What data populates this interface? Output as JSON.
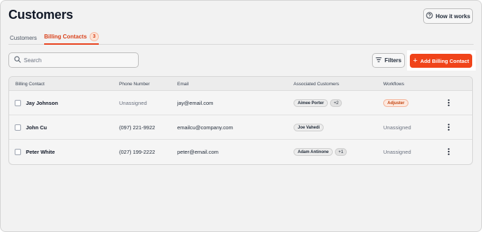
{
  "header": {
    "title": "Customers",
    "how_it_works_label": "How it works"
  },
  "tabs": [
    {
      "label": "Customers",
      "active": false
    },
    {
      "label": "Billing Contacts",
      "active": true,
      "count": "3"
    }
  ],
  "toolbar": {
    "search_placeholder": "Search",
    "search_value": "",
    "filters_label": "Filters",
    "add_label": "Add Billing Contact"
  },
  "table": {
    "columns": [
      "Billing Contact",
      "Phone Number",
      "Email",
      "Associated Customers",
      "Workflows"
    ],
    "rows": [
      {
        "name": "Jay Johnson",
        "phone": "Unassigned",
        "email": "jay@email.com",
        "customer": "Aimee Porter",
        "more": "+2",
        "workflow": "Adjuster"
      },
      {
        "name": "John Cu",
        "phone": "(097) 221-9922",
        "email": "emailcu@company.com",
        "customer": "Joe Vahedi",
        "workflow": "Unassigned"
      },
      {
        "name": "Peter White",
        "phone": "(027) 199-2222",
        "email": "peter@email.com",
        "customer": "Adam Antinone",
        "more": "+1",
        "workflow": "Unassigned"
      }
    ]
  },
  "colors": {
    "accent": "#f0441a",
    "tab_active": "#d9421b",
    "background": "#f2f2f2"
  },
  "icons": {
    "how_it_works": "question-circle-icon",
    "search": "search-icon",
    "filters": "filter-lines-icon",
    "add": "plus-icon",
    "row_menu": "kebab-menu-icon"
  }
}
